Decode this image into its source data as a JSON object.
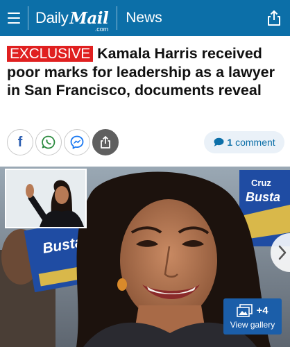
{
  "header": {
    "logo_daily": "Daily",
    "logo_mail": "Mail",
    "logo_com": ".com",
    "section": "News",
    "bg_color": "#0c6fa8"
  },
  "article": {
    "badge": "EXCLUSIVE",
    "title": "Kamala Harris received poor marks for leadership as a lawyer in San Francisco, documents reveal"
  },
  "share": {
    "buttons": [
      {
        "icon": "facebook-icon"
      },
      {
        "icon": "whatsapp-icon"
      },
      {
        "icon": "messenger-icon"
      },
      {
        "icon": "share-icon"
      }
    ],
    "comment_count": "1",
    "comment_label": "comment"
  },
  "hero": {
    "sign_text_1": "Bustar",
    "sign_text_2": "Cruz",
    "sign_text_3": "Busta",
    "gallery_count": "+4",
    "gallery_label": "View gallery"
  },
  "colors": {
    "accent": "#0c6fa8",
    "exclusive": "#e02020",
    "gallery": "#1b5ea9"
  }
}
